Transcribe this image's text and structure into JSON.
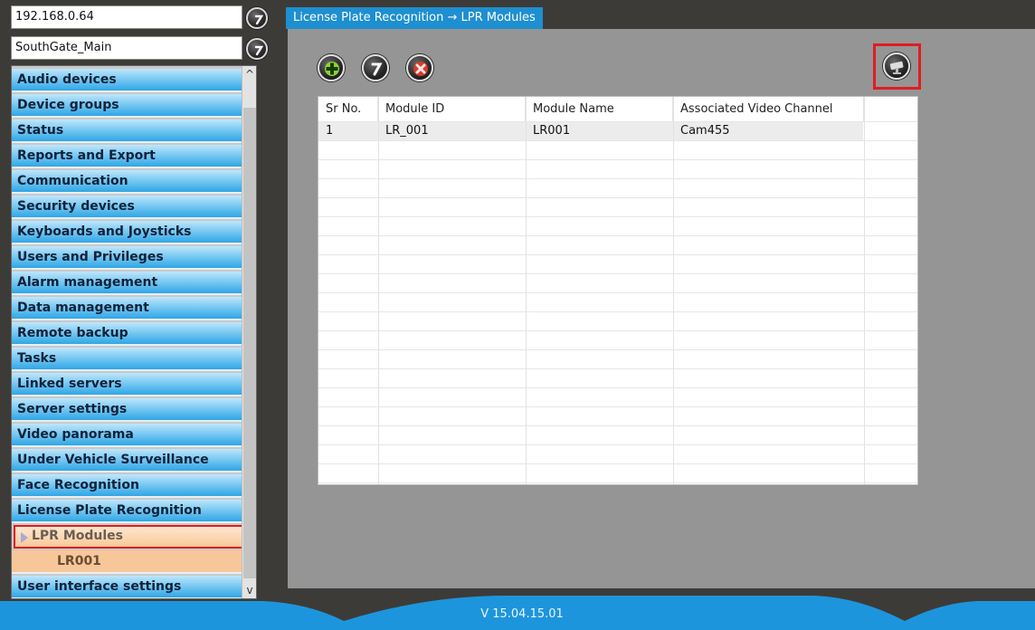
{
  "left": {
    "address": "192.168.0.64",
    "server_name": "SouthGate_Main",
    "menu": [
      "Audio devices",
      "Device groups",
      "Status",
      "Reports and Export",
      "Communication",
      "Security devices",
      "Keyboards and Joysticks",
      "Users and Privileges",
      "Alarm management",
      "Data management",
      "Remote backup",
      "Tasks",
      "Linked servers",
      "Server settings",
      "Video panorama",
      "Under Vehicle Surveillance",
      "Face Recognition",
      "License Plate Recognition"
    ],
    "selected_item": "LPR Modules",
    "child_item": "LR001",
    "last_item": "User interface settings",
    "scroll_up": "^",
    "scroll_down": "v"
  },
  "main": {
    "title": "License Plate Recognition → LPR Modules",
    "toolbar": {
      "add_icon": "add-icon",
      "help_icon": "help-icon",
      "delete_icon": "delete-icon",
      "camera_icon": "camera-icon"
    },
    "table": {
      "headers": [
        "Sr No.",
        "Module ID",
        "Module Name",
        "Associated Video Channel"
      ],
      "rows": [
        [
          "1",
          "LR_001",
          "LR001",
          "Cam455"
        ]
      ]
    }
  },
  "footer": {
    "version": "V 15.04.15.01"
  },
  "colors": {
    "accent_blue": "#1d95dc",
    "selection_red": "#e21b23",
    "background_dark": "#3d3b38",
    "content_gray": "#959595"
  }
}
